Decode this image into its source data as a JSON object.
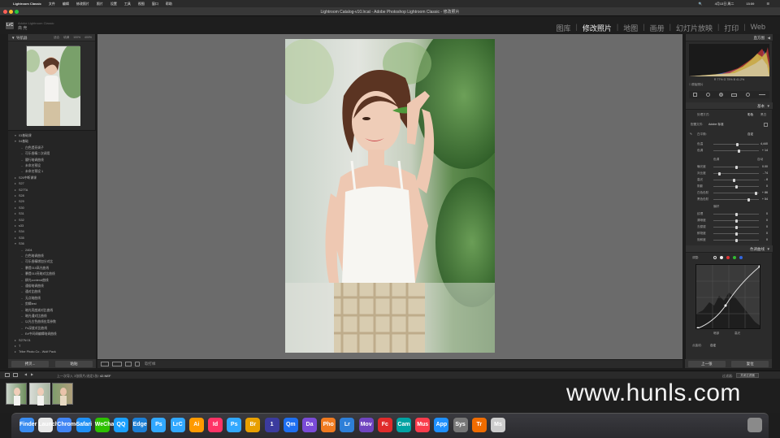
{
  "menubar": {
    "apple": "",
    "app_name": "Lightroom Classic",
    "items": [
      "文件",
      "编辑",
      "修改照片",
      "照片",
      "设置",
      "工具",
      "视图",
      "窗口",
      "帮助"
    ],
    "right_items": [
      "🔍",
      "4月13日 周二",
      "15:59",
      "☰"
    ]
  },
  "window": {
    "title": "Lightroom Catalog-v10.lrcat - Adobe Photoshop Lightroom Classic - 修改照片"
  },
  "header": {
    "logo": "LrC",
    "subtitle_top": "Adobe Lightroom Classic",
    "subtitle_bottom": "斋 壳",
    "modules": [
      {
        "label": "图库",
        "active": false
      },
      {
        "label": "修改照片",
        "active": true
      },
      {
        "label": "地图",
        "active": false
      },
      {
        "label": "画册",
        "active": false
      },
      {
        "label": "幻灯片放映",
        "active": false
      },
      {
        "label": "打印",
        "active": false
      },
      {
        "label": "Web",
        "active": false
      }
    ]
  },
  "left_panel": {
    "navigator_title": "导航器",
    "navigator_options": [
      "适合",
      "填满",
      "100%",
      "400%"
    ],
    "presets": [
      {
        "label": "03基础课",
        "indent": 1,
        "expanded": true
      },
      {
        "label": "04基础",
        "indent": 1,
        "expanded": true
      },
      {
        "label": "白色提亮调子",
        "indent": 3
      },
      {
        "label": "可乐香精二次调用",
        "indent": 3
      },
      {
        "label": "履行暗调曲线",
        "indent": 3
      },
      {
        "label": "未命名预设",
        "indent": 3
      },
      {
        "label": "未命名预设 1",
        "indent": 3
      },
      {
        "label": "S26中断课课",
        "indent": 1
      },
      {
        "label": "S27",
        "indent": 1
      },
      {
        "label": "S27TA",
        "indent": 1
      },
      {
        "label": "S28",
        "indent": 1
      },
      {
        "label": "S29",
        "indent": 1
      },
      {
        "label": "S30",
        "indent": 1
      },
      {
        "label": "S31",
        "indent": 1
      },
      {
        "label": "S32",
        "indent": 1
      },
      {
        "label": "s33",
        "indent": 1
      },
      {
        "label": "S34",
        "indent": 1
      },
      {
        "label": "S35",
        "indent": 1
      },
      {
        "label": "S36",
        "indent": 1,
        "expanded": true
      },
      {
        "label": "2404",
        "indent": 3
      },
      {
        "label": "白色暗调曲线",
        "indent": 3
      },
      {
        "label": "可乐香精增加分对比",
        "indent": 3
      },
      {
        "label": "暴提010高光曲线",
        "indent": 3
      },
      {
        "label": "暴提010亮暗对比曲线",
        "indent": 3
      },
      {
        "label": "柳光contend曲线",
        "indent": 3
      },
      {
        "label": "通俗暗调曲线",
        "indent": 3
      },
      {
        "label": "通对比曲线",
        "indent": 3
      },
      {
        "label": "无点暗曲线",
        "indent": 3
      },
      {
        "label": "剪辑test",
        "indent": 3
      },
      {
        "label": "暗光亮度减对比曲线",
        "indent": 3
      },
      {
        "label": "暗光通对比曲线",
        "indent": 3
      },
      {
        "label": "以光古色曲线应用参数",
        "indent": 3
      },
      {
        "label": "Fs深度对比曲线",
        "indent": 3
      },
      {
        "label": "Ex中间调编辑暗调曲线",
        "indent": 3
      },
      {
        "label": "S27N 01",
        "indent": 1
      },
      {
        "label": "T",
        "indent": 1
      },
      {
        "label": "Tribe Photo Co - Wolf Pack",
        "indent": 1
      }
    ],
    "copy_button": "拷贝...",
    "paste_button": "粘贴"
  },
  "toolbar": {
    "soft_proof_label": "软打样"
  },
  "right_panel": {
    "histogram_title": "直方图",
    "histogram_readout": "R 77% G 75% B 41.2%",
    "original_label": "□ 原始照片",
    "basic_title": "基本",
    "treatment_label": "处理方式:",
    "treatment_color": "彩色",
    "treatment_bw": "黑白",
    "profile_label": "配置文件:",
    "profile_value": "Adobe 标准",
    "wb_label": "白平衡:",
    "wb_value": "自定",
    "sliders_wb": [
      {
        "label": "色温",
        "value": "4,440",
        "position": 0.52
      },
      {
        "label": "色调",
        "value": "+ 14",
        "position": 0.56
      }
    ],
    "tone_label": "色调",
    "tone_auto": "自动",
    "sliders_tone": [
      {
        "label": "曝光度",
        "value": "0.00",
        "position": 0.5
      },
      {
        "label": "对比度",
        "value": "- 74",
        "position": 0.13
      },
      {
        "label": "高光",
        "value": "- 8",
        "position": 0.46
      },
      {
        "label": "阴影",
        "value": "0",
        "position": 0.5
      },
      {
        "label": "白色色阶",
        "value": "+ 86",
        "position": 0.93
      },
      {
        "label": "黑色色阶",
        "value": "+ 54",
        "position": 0.77
      }
    ],
    "presence_label": "偏好",
    "sliders_presence": [
      {
        "label": "纹理",
        "value": "0",
        "position": 0.5
      },
      {
        "label": "清晰度",
        "value": "0",
        "position": 0.5
      },
      {
        "label": "去朦胧",
        "value": "0",
        "position": 0.5
      },
      {
        "label": "鲜艳度",
        "value": "0",
        "position": 0.5
      },
      {
        "label": "饱和度",
        "value": "0",
        "position": 0.5
      }
    ],
    "curve_title": "色调曲线",
    "curve_adjust": "调整:",
    "curve_channel_label": "通道:",
    "curve_channel_value": "RGB",
    "curve_axis_left": "暗部",
    "curve_axis_right": "高光",
    "curve_preset_label": "点曲线:",
    "curve_preset_value": "自定",
    "prev_button": "上一张",
    "reset_button": "复位"
  },
  "filmstrip": {
    "nav_info": "上一次导入 3张照片/选定1张/",
    "file_name": "42.NEF",
    "filter_label": "过滤器:",
    "filter_value": "关闭过滤器",
    "thumbs": 3
  },
  "watermark": "www.hunls.com",
  "dock": {
    "icons": [
      "Finder",
      "Launchpad",
      "Chrome",
      "Safari",
      "WeChat",
      "QQ",
      "Edge",
      "Ps",
      "LrC",
      "Ai",
      "Id",
      "Ps",
      "Br",
      "1",
      "Qm",
      "Da",
      "Pho",
      "Lr",
      "Mov",
      "Fc",
      "Cam",
      "Mus",
      "App",
      "Sys",
      "Tr",
      "Ms"
    ]
  }
}
